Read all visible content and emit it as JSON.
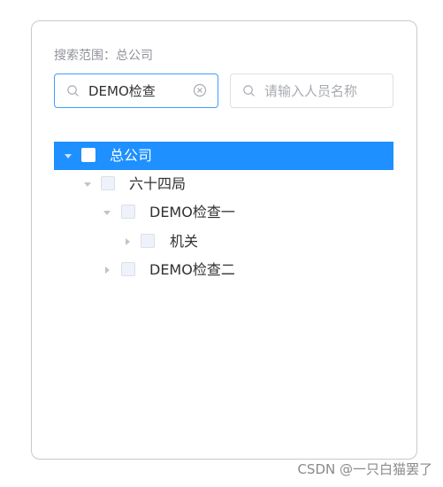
{
  "search_scope": "搜索范围：总公司",
  "dept_search": {
    "value": "DEMO检查"
  },
  "person_search": {
    "placeholder": "请输入人员名称"
  },
  "tree": [
    {
      "label": "总公司",
      "expanded": true,
      "selected": true
    },
    {
      "label": "六十四局",
      "expanded": true,
      "selected": false
    },
    {
      "label": "DEMO检查一",
      "expanded": true,
      "selected": false
    },
    {
      "label": "机关",
      "expanded": false,
      "selected": false
    },
    {
      "label": "DEMO检查二",
      "expanded": false,
      "selected": false
    }
  ],
  "watermark": "CSDN @一只白猫罢了",
  "colors": {
    "selected_row": "#1e90ff",
    "active_border": "#409eff"
  }
}
